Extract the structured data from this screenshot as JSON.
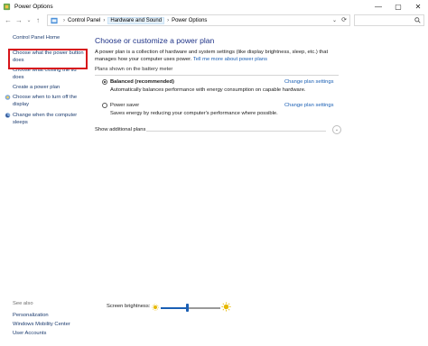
{
  "window": {
    "title": "Power Options",
    "controls": [
      "—",
      "▢",
      "✕"
    ]
  },
  "address": {
    "crumbs": [
      "Control Panel",
      "Hardware and Sound",
      "Power Options"
    ],
    "dropdown_glyph": "⌄",
    "refresh_glyph": "⟳"
  },
  "nav": {
    "back": "←",
    "forward": "→",
    "recent": "⌄",
    "up": "↑"
  },
  "sidebar": {
    "home": "Control Panel Home",
    "items": [
      "Choose what the power button does",
      "Choose what closing the lid does",
      "Create a power plan",
      "Choose when to turn off the display",
      "Change when the computer sleeps"
    ],
    "see_also_label": "See also",
    "see_also": [
      "Personalization",
      "Windows Mobility Center",
      "User Accounts"
    ]
  },
  "main": {
    "heading": "Choose or customize a power plan",
    "description": "A power plan is a collection of hardware and system settings (like display brightness, sleep, etc.) that manages how your computer uses power.",
    "description_link": "Tell me more about power plans",
    "section_header": "Plans shown on the battery meter",
    "plans": [
      {
        "name": "Balanced (recommended)",
        "description": "Automatically balances performance with energy consumption on capable hardware.",
        "link": "Change plan settings",
        "selected": true
      },
      {
        "name": "Power saver",
        "description": "Saves energy by reducing your computer's performance where possible.",
        "link": "Change plan settings",
        "selected": false
      }
    ],
    "show_additional": "Show additional plans",
    "show_additional_glyph": "⌄"
  },
  "brightness": {
    "label": "Screen brightness:",
    "level": 0.45
  },
  "colors": {
    "heading": "#1e3287",
    "link": "#1a5fb4",
    "highlight_box": "#d7141a"
  }
}
